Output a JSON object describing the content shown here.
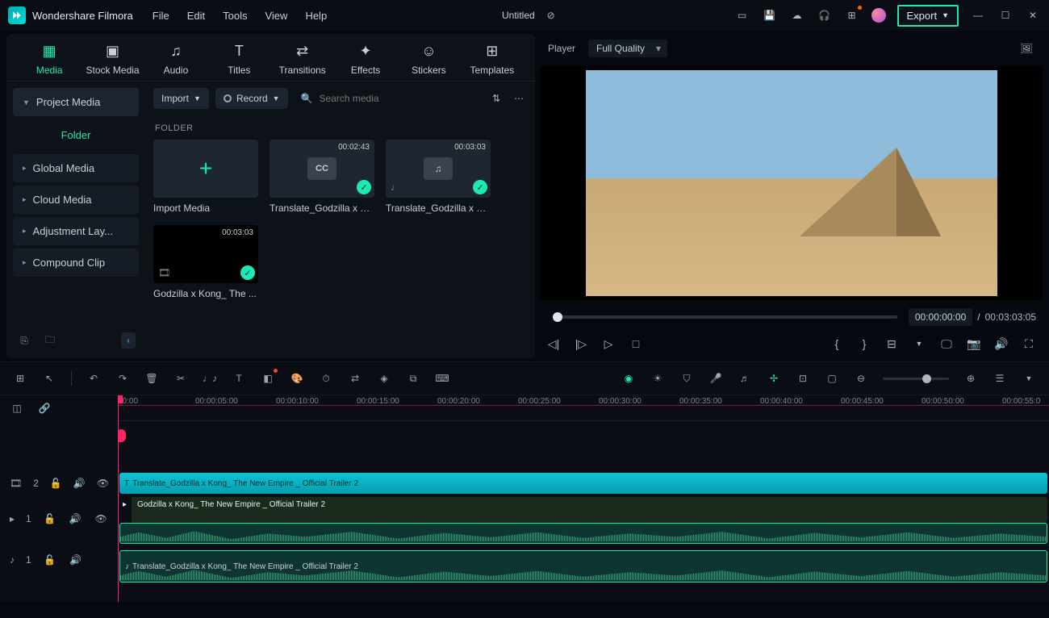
{
  "app": {
    "name": "Wondershare Filmora",
    "doc_title": "Untitled",
    "export": "Export"
  },
  "menu": {
    "file": "File",
    "edit": "Edit",
    "tools": "Tools",
    "view": "View",
    "help": "Help"
  },
  "tabs": {
    "media": "Media",
    "stock": "Stock Media",
    "audio": "Audio",
    "titles": "Titles",
    "transitions": "Transitions",
    "effects": "Effects",
    "stickers": "Stickers",
    "templates": "Templates"
  },
  "sidebar": {
    "project_media": "Project Media",
    "folder": "Folder",
    "global": "Global Media",
    "cloud": "Cloud Media",
    "adjustment": "Adjustment Lay...",
    "compound": "Compound Clip"
  },
  "content": {
    "import": "Import",
    "record": "Record",
    "search_placeholder": "Search media",
    "folder_label": "FOLDER"
  },
  "media_items": [
    {
      "name": "Import Media",
      "type": "import"
    },
    {
      "name": "Translate_Godzilla x K...",
      "dur": "00:02:43",
      "type": "cc"
    },
    {
      "name": "Translate_Godzilla x K...",
      "dur": "00:03:03",
      "type": "music"
    },
    {
      "name": "Godzilla x Kong_ The ...",
      "dur": "00:03:03",
      "type": "video"
    }
  ],
  "player": {
    "label": "Player",
    "quality": "Full Quality",
    "time_current": "00:00:00:00",
    "time_separator": "/",
    "time_total": "00:03:03:05"
  },
  "ruler": [
    "00:00",
    "00:00:05:00",
    "00:00:10:00",
    "00:00:15:00",
    "00:00:20:00",
    "00:00:25:00",
    "00:00:30:00",
    "00:00:35:00",
    "00:00:40:00",
    "00:00:45:00",
    "00:00:50:00",
    "00:00:55:0"
  ],
  "tracks": {
    "t2_label": "2",
    "t1_label": "1",
    "a1_label": "1",
    "clip_title": "Translate_Godzilla x Kong_ The New Empire _ Official Trailer 2",
    "clip_video": "Godzilla x Kong_ The New Empire _ Official Trailer 2",
    "clip_audio": "Translate_Godzilla x Kong_ The New Empire _ Official Trailer 2"
  }
}
